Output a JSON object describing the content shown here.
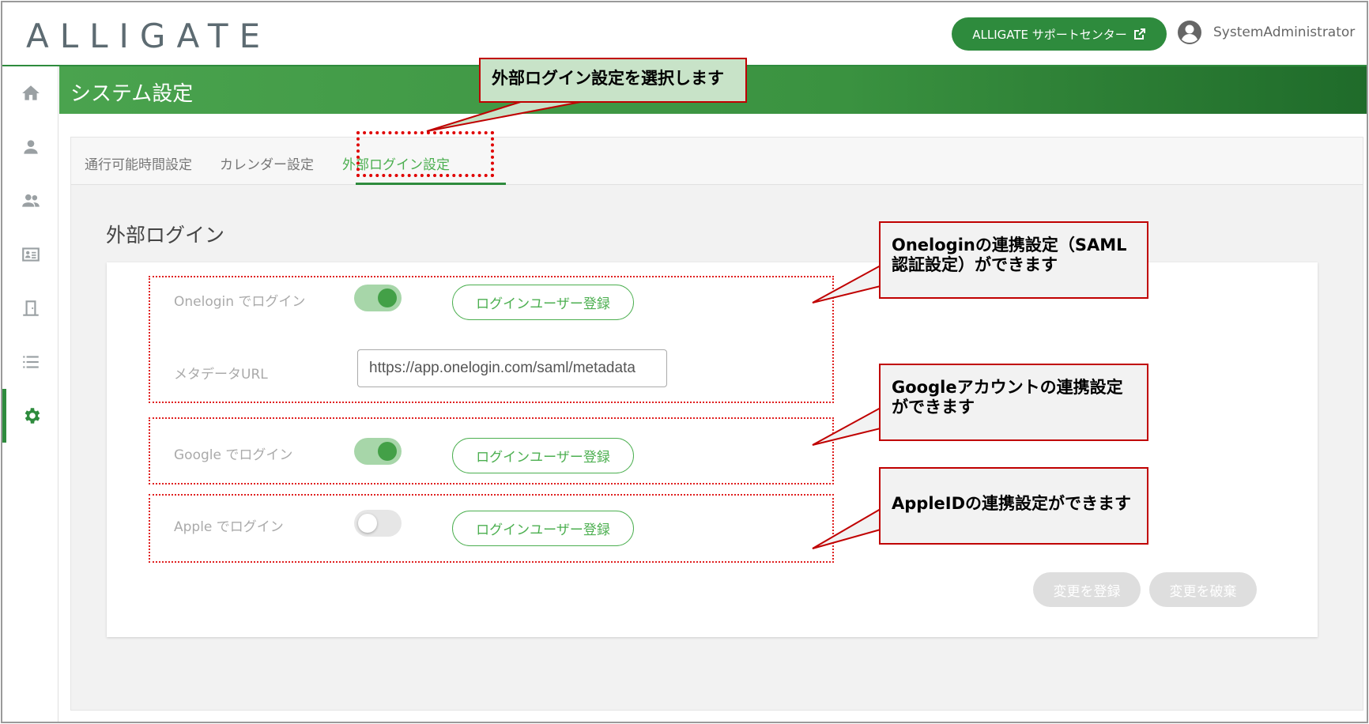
{
  "header": {
    "logo": "ALLIGATE",
    "support_label": "ALLIGATE サポートセンター",
    "user_name": "SystemAdministrator"
  },
  "sidebar": {
    "items": [
      {
        "icon": "home-icon"
      },
      {
        "icon": "person-icon"
      },
      {
        "icon": "group-icon"
      },
      {
        "icon": "id-card-icon"
      },
      {
        "icon": "door-icon"
      },
      {
        "icon": "list-icon"
      },
      {
        "icon": "gear-icon",
        "active": true
      }
    ]
  },
  "page": {
    "title": "システム設定",
    "tabs": [
      "通行可能時間設定",
      "カレンダー設定",
      "外部ログイン設定"
    ],
    "active_tab": "外部ログイン設定",
    "section_title": "外部ログイン"
  },
  "settings": {
    "onelogin": {
      "label": "Onelogin でログイン",
      "enabled": true,
      "button": "ログインユーザー登録"
    },
    "metadata": {
      "label": "メタデータURL",
      "value": "https://app.onelogin.com/saml/metadata"
    },
    "google": {
      "label": "Google でログイン",
      "enabled": true,
      "button": "ログインユーザー登録"
    },
    "apple": {
      "label": "Apple でログイン",
      "enabled": false,
      "button": "ログインユーザー登録"
    }
  },
  "footer": {
    "save_label": "変更を登録",
    "discard_label": "変更を破棄"
  },
  "annotations": {
    "tab_note": "外部ログイン設定を選択します",
    "onelogin_note_1": "Oneloginの連携設定（SAML",
    "onelogin_note_2": "認証設定）ができます",
    "google_note_1": "Googleアカウントの連携設定",
    "google_note_2": "ができます",
    "apple_note": "AppleIDの連携設定ができます"
  },
  "colors": {
    "brand_green": "#2e8b3d",
    "accent_green": "#4caf50",
    "annotation_red": "#c00000"
  }
}
